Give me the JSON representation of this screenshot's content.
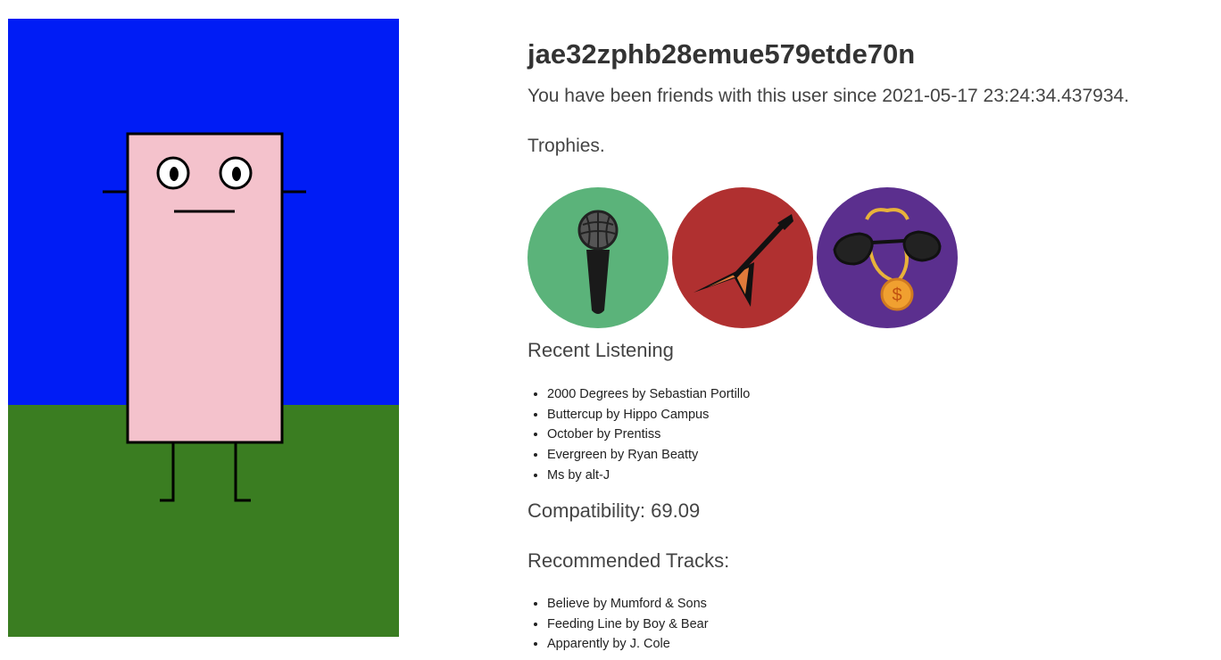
{
  "user": {
    "username": "jae32zphb28emue579etde70n",
    "friends_since": "You have been friends with this user since 2021-05-17 23:24:34.437934."
  },
  "trophies": {
    "heading": "Trophies.",
    "items": [
      {
        "icon": "microphone-icon",
        "color": "#5bb37a"
      },
      {
        "icon": "guitar-icon",
        "color": "#b03030"
      },
      {
        "icon": "sunglasses-chain-icon",
        "color": "#5b2f8e"
      }
    ]
  },
  "recent_listening": {
    "heading": "Recent Listening",
    "tracks": [
      "2000 Degrees by Sebastian Portillo",
      "Buttercup by Hippo Campus",
      "October by Prentiss",
      "Evergreen by Ryan Beatty",
      "Ms by alt-J"
    ]
  },
  "compatibility": "Compatibility: 69.09",
  "recommended": {
    "heading": "Recommended Tracks:",
    "tracks": [
      "Believe by Mumford & Sons",
      "Feeding Line by Boy & Bear",
      "Apparently by J. Cole"
    ]
  },
  "colors": {
    "sky": "#001cf5",
    "grass": "#3a7d21",
    "character_body": "#f4c2cc"
  }
}
